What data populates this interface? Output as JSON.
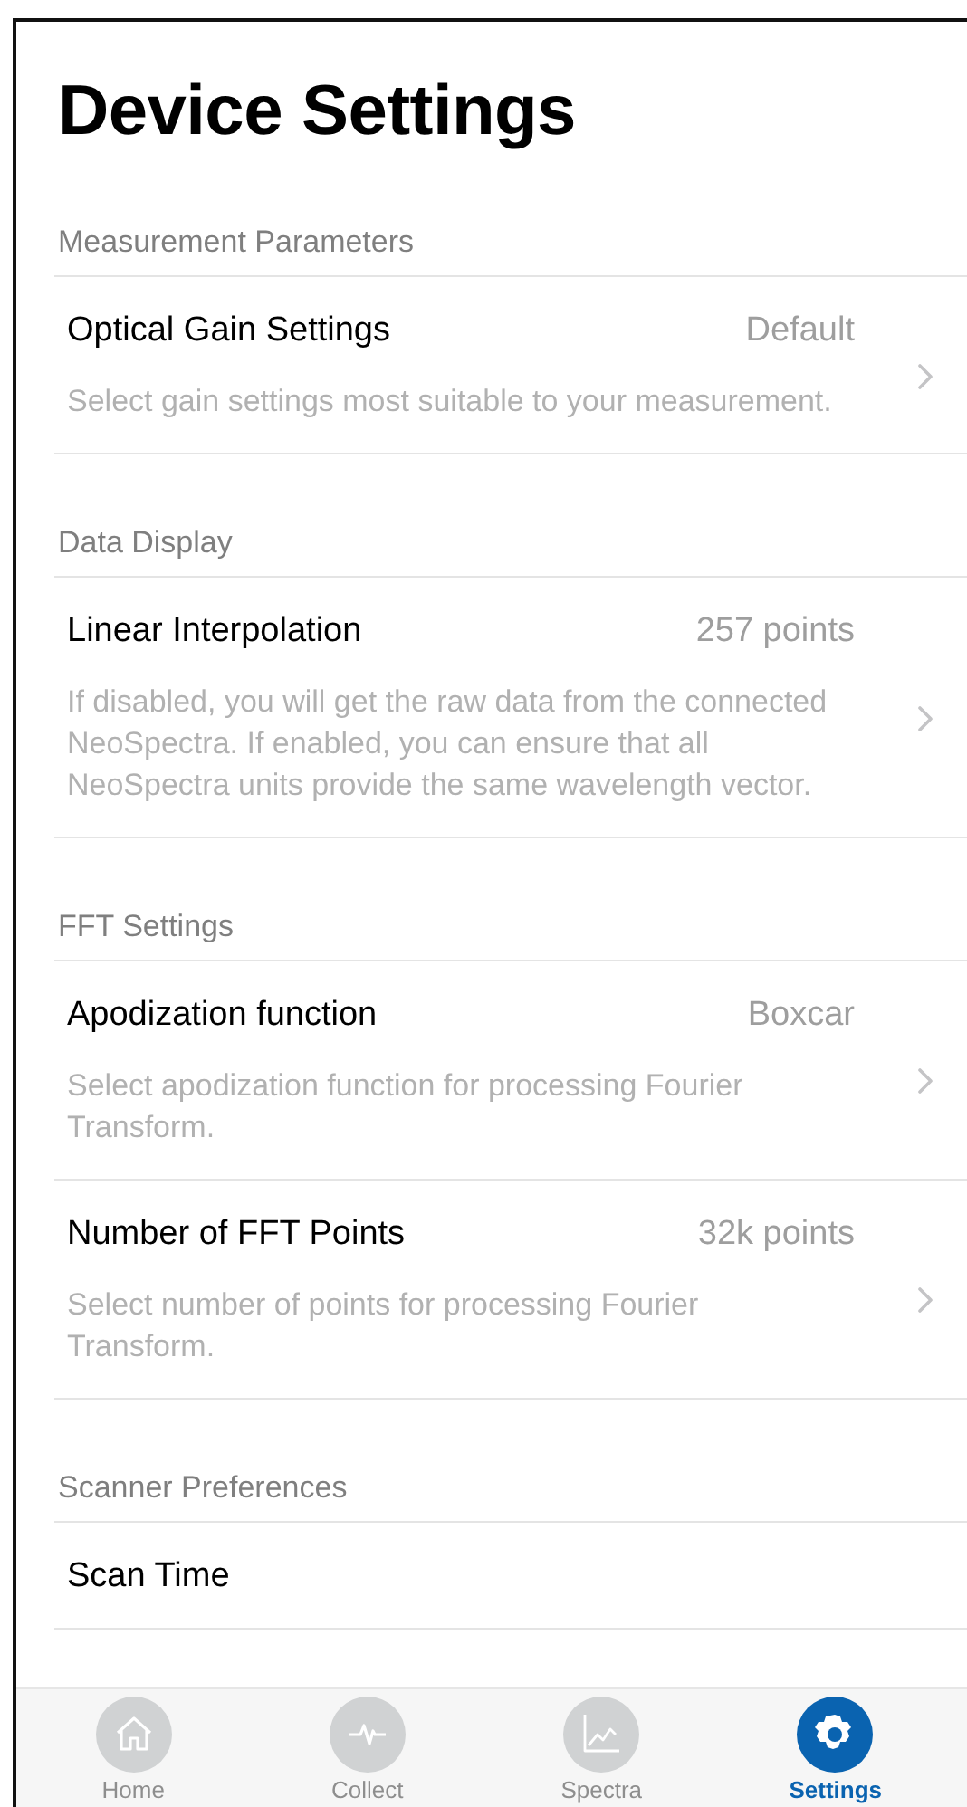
{
  "title": "Device Settings",
  "sections": [
    {
      "header": "Measurement Parameters",
      "rows": [
        {
          "title": "Optical Gain Settings",
          "value": "Default",
          "description": "Select gain settings most suitable to your measurement."
        }
      ]
    },
    {
      "header": "Data Display",
      "rows": [
        {
          "title": "Linear Interpolation",
          "value": "257 points",
          "description": "If disabled, you will get the raw data from the connected NeoSpectra. If enabled, you can ensure that all NeoSpectra units provide the same wavelength vector."
        }
      ]
    },
    {
      "header": "FFT Settings",
      "rows": [
        {
          "title": "Apodization function",
          "value": "Boxcar",
          "description": "Select apodization function for processing Fourier Transform."
        },
        {
          "title": "Number of FFT Points",
          "value": "32k points",
          "description": "Select number of points for processing Fourier Transform."
        }
      ]
    },
    {
      "header": "Scanner Preferences",
      "rows": [
        {
          "title": "Scan Time"
        }
      ]
    }
  ],
  "tabs": [
    {
      "label": "Home",
      "selected": false
    },
    {
      "label": "Collect",
      "selected": false
    },
    {
      "label": "Spectra",
      "selected": false
    },
    {
      "label": "Settings",
      "selected": true
    }
  ]
}
